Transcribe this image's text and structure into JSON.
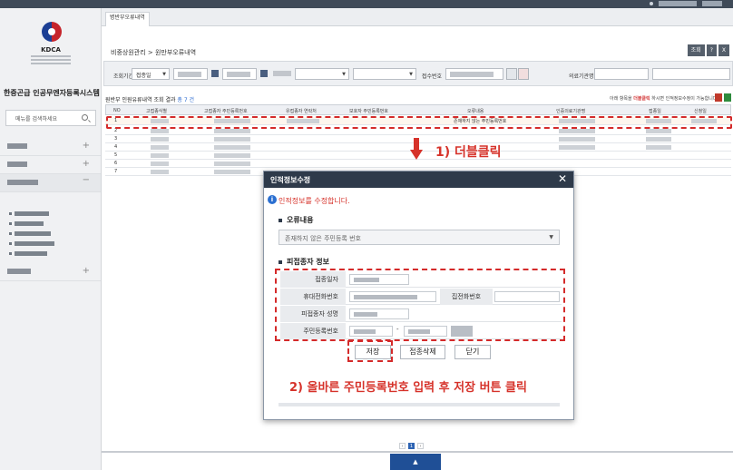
{
  "sidebar": {
    "logo_text": "KDCA",
    "system_title": "한중곤급 인공무엔자등록시스템",
    "search_placeholder": "메뉴를 검색하세요",
    "menu_plus": "+"
  },
  "main": {
    "tab_label": "병반부오류내역",
    "breadcrumb": "비중상원관리 > 원만부오류내역",
    "top_buttons": [
      "조회",
      "?",
      "X"
    ],
    "filters": {
      "label1": "조회기간",
      "period_value": "접종일",
      "label2": "접수번호",
      "label3": "의료기관명"
    },
    "result_title": "원반부 인원유류내역 조회 결과",
    "result_count": "총 7 건",
    "result_note_pre": "아래 항목을",
    "result_note_hl": "더블클릭",
    "result_note_post": "하시면 인적정보수정이 가능합니다."
  },
  "grid": {
    "headers": [
      "NO",
      "고접종식별",
      "고접종자 주민등록번호",
      "유접종자 연락처",
      "보호자 주민등록번호",
      "오류내용",
      "인증의료기관명",
      "접종일",
      "신청일"
    ],
    "selected_row_error": "존재하지 않는 주민등록번호",
    "row_numbers": [
      "1",
      "2",
      "3",
      "4",
      "5",
      "6",
      "7"
    ]
  },
  "annotations": {
    "step1": "1) 더블클릭",
    "step2": "2) 올바른 주민등록번호 입력 후 저장 버튼 클릭"
  },
  "modal": {
    "title": "인적정보수정",
    "close": "✕",
    "info_text": "인적정보를 수정합니다.",
    "section_error": "오류내용",
    "error_value": "존재하지 않은 주민등록 번호",
    "section_person": "피접종자 정보",
    "fields": {
      "date": "접종일자",
      "phone": "휴대전화번호",
      "home": "집전화번호",
      "name": "피접종자 성명",
      "rrn": "주민등록번호"
    },
    "btn_save": "저장",
    "btn_delete": "접종삭제",
    "btn_close": "닫기"
  },
  "pager": {
    "pages": [
      "‹",
      "1",
      "›"
    ],
    "current": "1"
  },
  "bottom": {
    "up_button": "▲"
  },
  "colors": {
    "header_dark": "#2e3a4a",
    "annotation_red": "#d6322a",
    "accent_blue": "#2d63b3"
  }
}
